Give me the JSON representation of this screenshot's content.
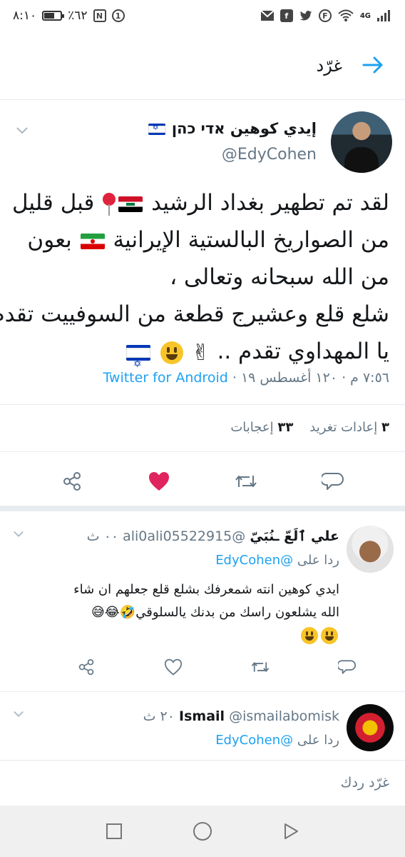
{
  "status_bar": {
    "time": "٨:١٠",
    "battery_text": "٪٦٢",
    "battery_level": 0.62,
    "network_label": "4G",
    "icons": [
      "nfc-icon",
      "notification-icon",
      "signal-icon",
      "wifi-icon",
      "f-circle-icon",
      "twitter-icon",
      "facebook-icon",
      "email-icon"
    ]
  },
  "header": {
    "title": "غرّد",
    "back_icon": "arrow-right-icon"
  },
  "tweet": {
    "author_name": "إيدي كوهين אדי כהן",
    "author_handle": "@EdyCohen",
    "lines": [
      "لقد تم تطهير بغداد الرشيد",
      "قبل قليل",
      "من الصواريخ البالستية الإيرانية",
      "بعون",
      "من الله سبحانه وتعالى ،",
      "شلع قلع وعشيرج قطعة من السوفييت تقدم",
      "يا المهداوي تقدم .."
    ],
    "timestamp": "٧:٥٦ م · ١٢٠ أغسطس ١٩ ·",
    "source": "Twitter for Android",
    "retweets_count": "٣",
    "retweets_label": "إعادات تغريد",
    "likes_count": "٣٣",
    "likes_label": "إعجابات",
    "liked": true
  },
  "replies": [
    {
      "name": "علي ٱلَعّ ـنُبَيّ",
      "handle": "@ali0ali05522915",
      "time": "٠٠ ث",
      "reply_to_prefix": "ردا على",
      "reply_to_handle": "@EdyCohen",
      "lines": [
        "ايدي كوهين انته شمعرفك بشلع قلع جعلهم ان شاء",
        "الله يشلعون راسك من بدنك يالسلوقي🤣😂😅"
      ]
    },
    {
      "name": "Ismail",
      "handle": "@ismailabomisk",
      "time": "٢٠ ث",
      "reply_to_prefix": "ردا على",
      "reply_to_handle": "@EdyCohen"
    }
  ],
  "compose": {
    "placeholder": "غرّد ردك"
  },
  "colors": {
    "accent": "#1da1f2",
    "like": "#e0245e",
    "muted": "#657786",
    "text": "#14171a"
  }
}
